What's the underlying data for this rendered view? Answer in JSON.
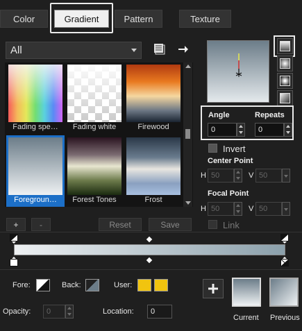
{
  "tabs": [
    {
      "label": "Color"
    },
    {
      "label": "Gradient"
    },
    {
      "label": "Pattern"
    },
    {
      "label": "Texture"
    }
  ],
  "category": {
    "selected": "All"
  },
  "gallery": {
    "items": [
      {
        "label": "Fading spe…"
      },
      {
        "label": "Fading white"
      },
      {
        "label": "Firewood"
      },
      {
        "label": "Foregroun…"
      },
      {
        "label": "Forest Tones"
      },
      {
        "label": "Frost"
      }
    ]
  },
  "gallery_buttons": {
    "add": "+",
    "remove": "-",
    "reset": "Reset",
    "save": "Save"
  },
  "angle": {
    "label": "Angle",
    "value": "0"
  },
  "repeats": {
    "label": "Repeats",
    "value": "0"
  },
  "invert": {
    "label": "Invert",
    "checked": false
  },
  "center_point": {
    "label": "Center Point",
    "h_label": "H",
    "h_value": "50",
    "v_label": "V",
    "v_value": "50"
  },
  "focal_point": {
    "label": "Focal Point",
    "h_label": "H",
    "h_value": "50",
    "v_label": "V",
    "v_value": "50"
  },
  "link": {
    "label": "Link",
    "checked": false
  },
  "colors": {
    "fore_label": "Fore:",
    "back_label": "Back:",
    "user_label": "User:",
    "user_color": "#f1c40f",
    "accent": "#1c6fc7",
    "gradient_start": "#eef1f3",
    "gradient_end": "#8ba0ab"
  },
  "opacity": {
    "label": "Opacity:",
    "value": "0"
  },
  "location": {
    "label": "Location:",
    "value": "0"
  },
  "current": {
    "label": "Current"
  },
  "previous": {
    "label": "Previous"
  }
}
